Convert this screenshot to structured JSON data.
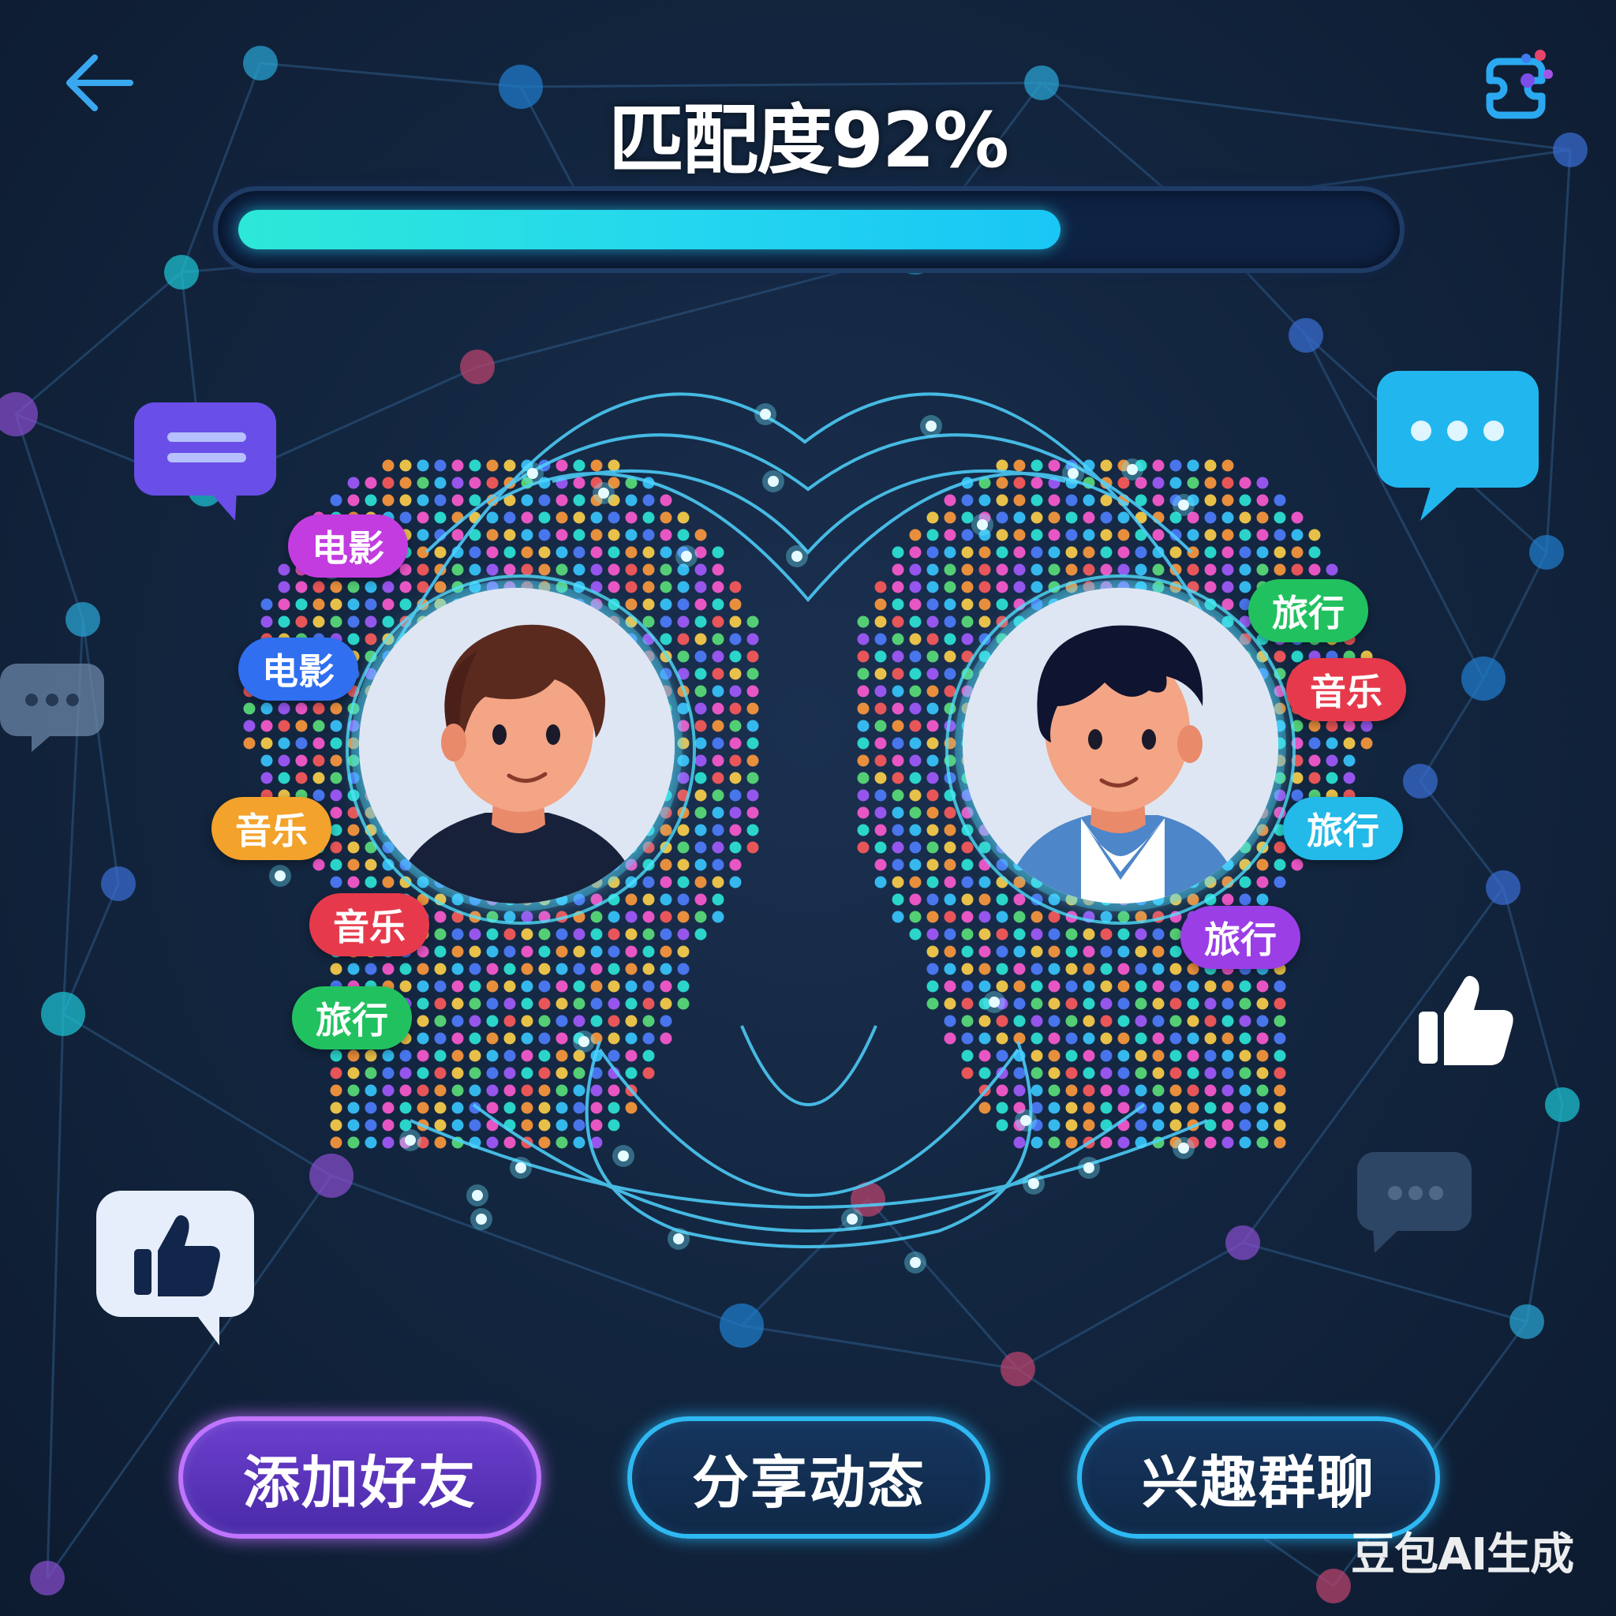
{
  "header": {
    "back_icon": "arrow-left-icon",
    "title": "匹配度92%",
    "assistant_icon": "ai-bot-icon"
  },
  "match": {
    "progress": 0.92,
    "colors": {
      "fill_start": "#2de8d8",
      "fill_end": "#19c6f5",
      "track": "#0e2244"
    }
  },
  "left_profile": {
    "tags": [
      "电影",
      "电影",
      "音乐",
      "音乐",
      "旅行"
    ]
  },
  "right_profile": {
    "tags": [
      "旅行",
      "音乐",
      "旅行",
      "旅行"
    ]
  },
  "decorations": {
    "icons": [
      "chat-bubble-lines-icon",
      "chat-bubble-dots-icon",
      "thumbs-up-icon"
    ]
  },
  "actions": {
    "add_friend": "添加好友",
    "share_post": "分享动态",
    "interest_group": "兴趣群聊"
  },
  "watermark": "豆包AI生成",
  "theme": {
    "background": "#132640",
    "accent_cyan": "#2fb8f2",
    "accent_purple": "#c074ff"
  }
}
